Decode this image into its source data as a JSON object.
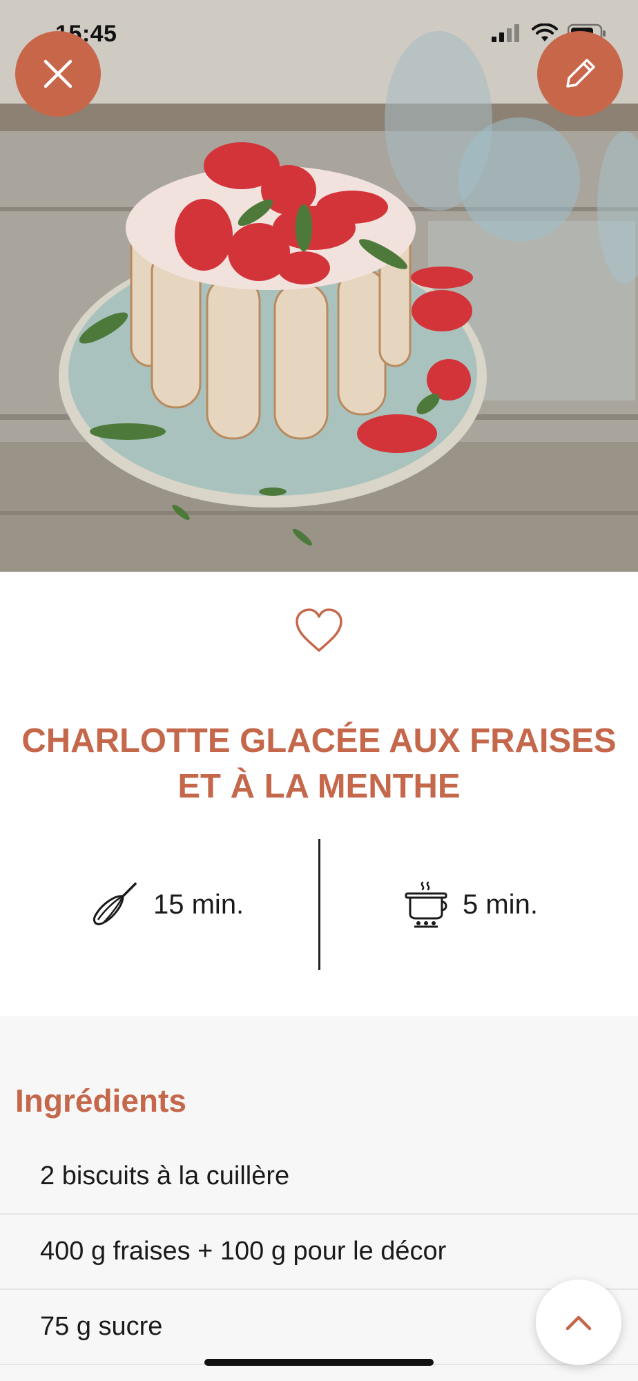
{
  "status_bar": {
    "time": "15:45",
    "icons": [
      "cellular-signal-icon",
      "wifi-icon",
      "battery-icon"
    ]
  },
  "hero": {
    "image": "photo-charlotte-cake"
  },
  "buttons": {
    "close": "close-icon",
    "edit": "pencil-icon",
    "favorite": "heart-outline-icon",
    "scroll_top": "chevron-up-icon"
  },
  "recipe": {
    "title": "CHARLOTTE GLACÉE AUX FRAISES ET À LA MENTHE",
    "prep_time": "15 min.",
    "cook_time": "5 min.",
    "prep_icon": "whisk-icon",
    "cook_icon": "cooking-pot-icon"
  },
  "ingredients": {
    "heading": "Ingrédients",
    "items": [
      "2 biscuits à la cuillère",
      "400 g fraises + 100 g pour le décor",
      "75 g sucre"
    ]
  },
  "colors": {
    "accent": "#c4674a",
    "button": "#c8664a",
    "section_bg": "#f7f7f7"
  }
}
